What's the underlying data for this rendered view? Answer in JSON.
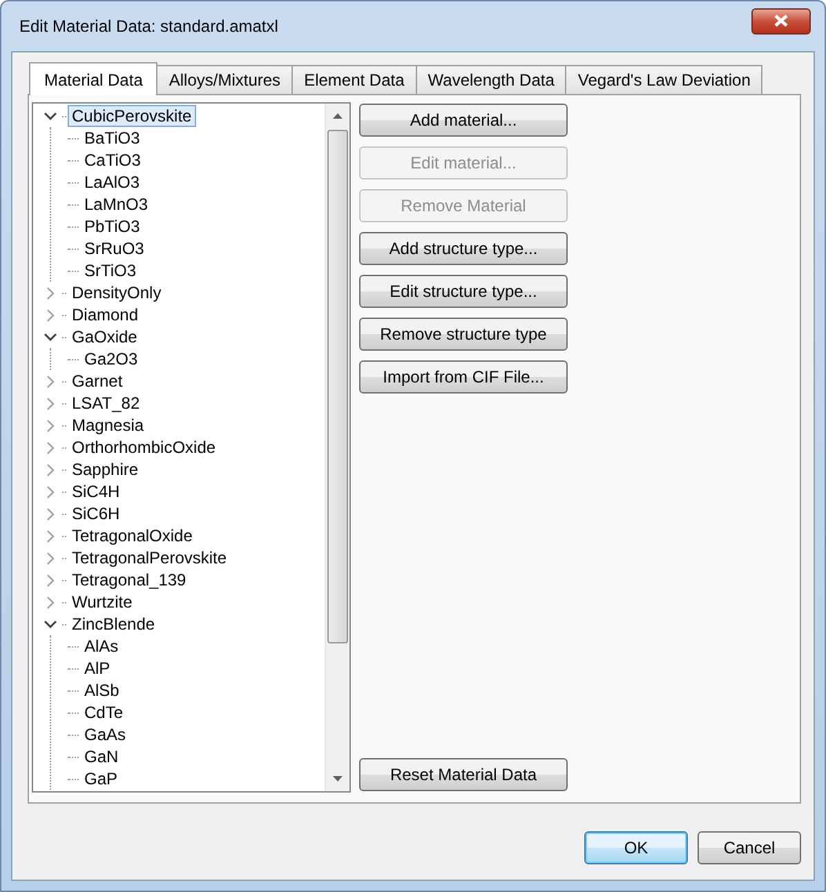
{
  "window": {
    "title": "Edit Material Data: standard.amatxl"
  },
  "tabs": [
    {
      "label": "Material Data",
      "selected": true
    },
    {
      "label": "Alloys/Mixtures",
      "selected": false
    },
    {
      "label": "Element Data",
      "selected": false
    },
    {
      "label": "Wavelength Data",
      "selected": false
    },
    {
      "label": "Vegard's Law Deviation",
      "selected": false
    }
  ],
  "tree": [
    {
      "label": "CubicPerovskite",
      "selected": true,
      "expanded": true,
      "children": [
        {
          "label": "BaTiO3",
          "selected": false
        },
        {
          "label": "CaTiO3",
          "selected": false
        },
        {
          "label": "LaAlO3",
          "selected": false
        },
        {
          "label": "LaMnO3",
          "selected": false
        },
        {
          "label": "PbTiO3",
          "selected": false
        },
        {
          "label": "SrRuO3",
          "selected": false
        },
        {
          "label": "SrTiO3",
          "selected": false
        }
      ]
    },
    {
      "label": "DensityOnly",
      "selected": false,
      "expanded": false
    },
    {
      "label": "Diamond",
      "selected": false,
      "expanded": false
    },
    {
      "label": "GaOxide",
      "selected": false,
      "expanded": true,
      "children": [
        {
          "label": "Ga2O3",
          "selected": false
        }
      ]
    },
    {
      "label": "Garnet",
      "selected": false,
      "expanded": false
    },
    {
      "label": "LSAT_82",
      "selected": false,
      "expanded": false
    },
    {
      "label": "Magnesia",
      "selected": false,
      "expanded": false
    },
    {
      "label": "OrthorhombicOxide",
      "selected": false,
      "expanded": false
    },
    {
      "label": "Sapphire",
      "selected": false,
      "expanded": false
    },
    {
      "label": "SiC4H",
      "selected": false,
      "expanded": false
    },
    {
      "label": "SiC6H",
      "selected": false,
      "expanded": false
    },
    {
      "label": "TetragonalOxide",
      "selected": false,
      "expanded": false
    },
    {
      "label": "TetragonalPerovskite",
      "selected": false,
      "expanded": false
    },
    {
      "label": "Tetragonal_139",
      "selected": false,
      "expanded": false
    },
    {
      "label": "Wurtzite",
      "selected": false,
      "expanded": false
    },
    {
      "label": "ZincBlende",
      "selected": false,
      "expanded": true,
      "children": [
        {
          "label": "AlAs",
          "selected": false
        },
        {
          "label": "AlP",
          "selected": false
        },
        {
          "label": "AlSb",
          "selected": false
        },
        {
          "label": "CdTe",
          "selected": false
        },
        {
          "label": "GaAs",
          "selected": false
        },
        {
          "label": "GaN",
          "selected": false
        },
        {
          "label": "GaP",
          "selected": false
        }
      ]
    }
  ],
  "actions": [
    {
      "label": "Add material...",
      "disabled": false
    },
    {
      "label": "Edit material...",
      "disabled": true
    },
    {
      "label": "Remove Material",
      "disabled": true
    },
    {
      "label": "Add structure type...",
      "disabled": false
    },
    {
      "label": "Edit structure type...",
      "disabled": false
    },
    {
      "label": "Remove structure type",
      "disabled": false
    },
    {
      "label": "Import from CIF File...",
      "disabled": false
    }
  ],
  "reset_button": {
    "label": "Reset Material Data",
    "disabled": false
  },
  "dialog_buttons": [
    {
      "label": "OK",
      "kind": "default"
    },
    {
      "label": "Cancel",
      "kind": "normal"
    }
  ]
}
